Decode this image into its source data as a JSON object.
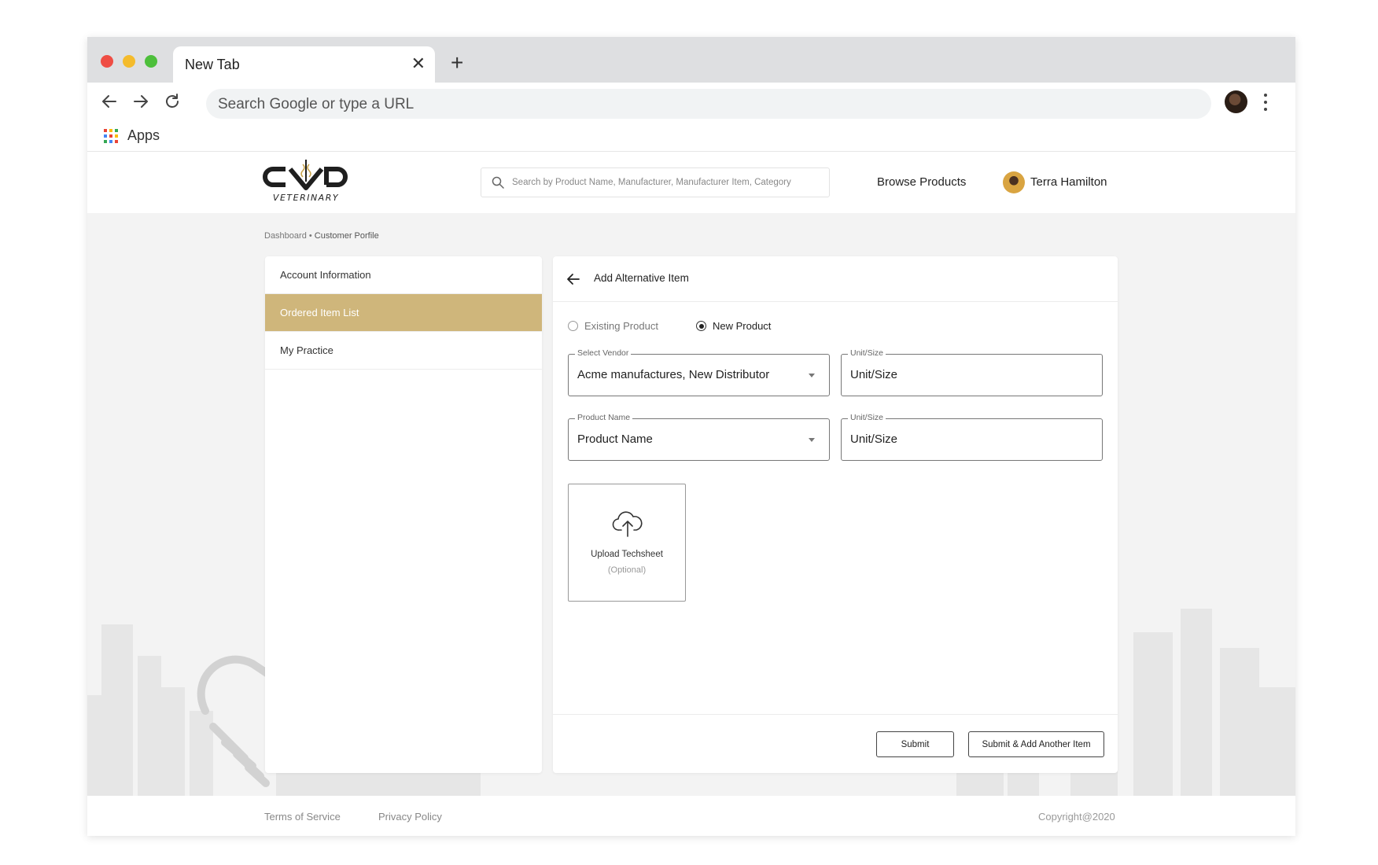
{
  "browser": {
    "tab_title": "New Tab",
    "close_tab_glyph": "✕",
    "new_tab_glyph": "+",
    "omnibox_placeholder": "Search Google or type a URL",
    "bookmark_apps": "Apps"
  },
  "header": {
    "logo_text": "VETERINARY",
    "search_placeholder": "Search by  Product Name, Manufacturer, Manufacturer Item, Category",
    "browse_link": "Browse Products",
    "user_name": "Terra Hamilton"
  },
  "breadcrumb": {
    "root": "Dashboard",
    "separator": " • ",
    "current": "Customer Porfile"
  },
  "sidebar": {
    "items": [
      {
        "label": "Account Information",
        "active": false
      },
      {
        "label": "Ordered Item List",
        "active": true
      },
      {
        "label": "My Practice",
        "active": false
      }
    ]
  },
  "form": {
    "title": "Add Alternative Item",
    "options": [
      {
        "label": "Existing Product",
        "selected": false
      },
      {
        "label": "New Product",
        "selected": true
      }
    ],
    "fields": [
      {
        "label": "Select Vendor",
        "value": "Acme manufactures, New Distributor",
        "dropdown": true
      },
      {
        "label": "Unit/Size",
        "value": "Unit/Size",
        "dropdown": false
      },
      {
        "label": "Product Name",
        "value": "Product Name",
        "dropdown": true
      },
      {
        "label": "Unit/Size",
        "value": "Unit/Size",
        "dropdown": false
      }
    ],
    "upload": {
      "label": "Upload Techsheet",
      "sub": "(Optional)"
    },
    "submit": "Submit",
    "submit_add": "Submit & Add Another Item"
  },
  "footer": {
    "terms": "Terms of Service",
    "privacy": "Privacy Policy",
    "copyright": "Copyright@2020"
  },
  "colors": {
    "accent": "#cfb67b",
    "mac_red": "#ef4d44",
    "mac_yellow": "#f4bb2c",
    "mac_green": "#4dbf3b"
  }
}
